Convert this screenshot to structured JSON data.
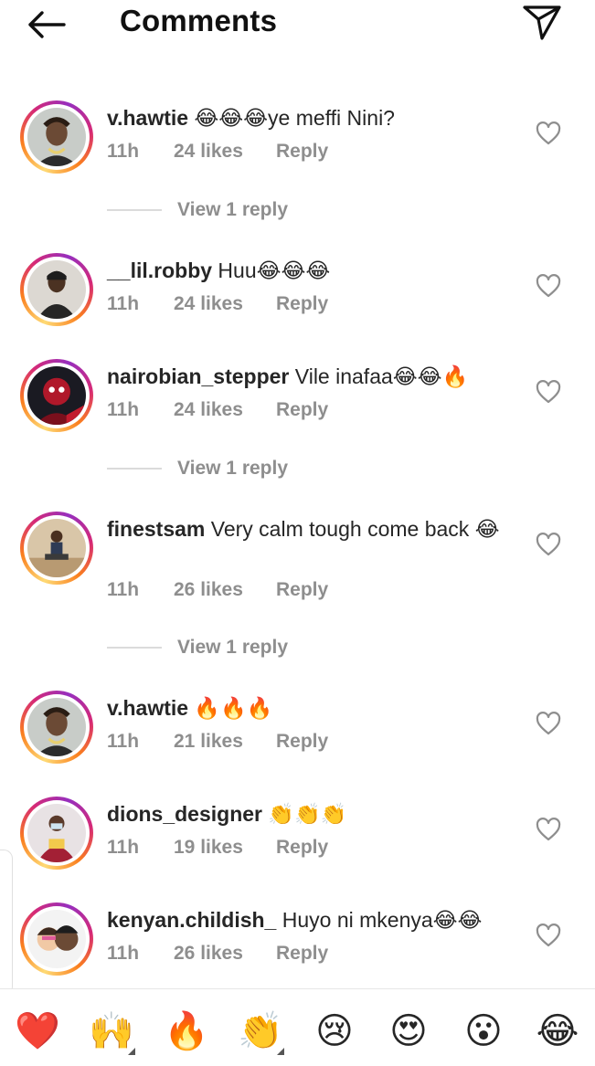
{
  "header": {
    "title": "Comments"
  },
  "comments": [
    {
      "username": "v.hawtie",
      "text": " 😂😂😂ye meffi Nini?",
      "time": "11h",
      "likes": "24 likes",
      "reply": "Reply",
      "view_reply": "View 1 reply"
    },
    {
      "username": "__lil.robby",
      "text": " Huu😂😂😂",
      "time": "11h",
      "likes": "24 likes",
      "reply": "Reply"
    },
    {
      "username": "nairobian_stepper",
      "text": " Vile inafaa😂😂🔥",
      "time": "11h",
      "likes": "24 likes",
      "reply": "Reply",
      "view_reply": "View 1 reply"
    },
    {
      "username": "finestsam",
      "text": " Very calm tough come back 😂",
      "time": "11h",
      "likes": "26 likes",
      "reply": "Reply",
      "view_reply": "View 1 reply"
    },
    {
      "username": "v.hawtie",
      "text": " 🔥🔥🔥",
      "time": "11h",
      "likes": "21 likes",
      "reply": "Reply"
    },
    {
      "username": "dions_designer",
      "text": " 👏👏👏",
      "time": "11h",
      "likes": "19 likes",
      "reply": "Reply"
    },
    {
      "username": "kenyan.childish_",
      "text": " Huyo ni mkenya😂😂",
      "time": "11h",
      "likes": "26 likes",
      "reply": "Reply"
    }
  ],
  "emoji_bar": [
    "❤️",
    "🙌",
    "🔥",
    "👏",
    "😢",
    "😍",
    "😮",
    "😂"
  ],
  "colors": {
    "text": "#262626",
    "meta": "#8e8e8e",
    "divider": "#dbdbdb"
  }
}
